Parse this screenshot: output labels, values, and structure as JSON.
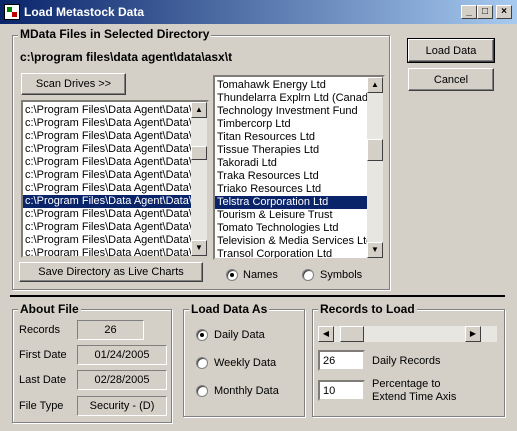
{
  "window": {
    "title": "Load Metastock Data",
    "min_glyph": "_",
    "max_glyph": "□",
    "close_glyph": "×"
  },
  "data_files": {
    "legend": "MData Files in Selected Directory",
    "path": "c:\\program files\\data agent\\data\\asx\\t",
    "scan_label": "Scan Drives >>",
    "save_dir_label": "Save Directory as Live Charts",
    "dirs": [
      "c:\\Program Files\\Data Agent\\Data\\",
      "c:\\Program Files\\Data Agent\\Data\\",
      "c:\\Program Files\\Data Agent\\Data\\",
      "c:\\Program Files\\Data Agent\\Data\\",
      "c:\\Program Files\\Data Agent\\Data\\",
      "c:\\Program Files\\Data Agent\\Data\\",
      "c:\\Program Files\\Data Agent\\Data\\",
      "c:\\Program Files\\Data Agent\\Data\\",
      "c:\\Program Files\\Data Agent\\Data\\",
      "c:\\Program Files\\Data Agent\\Data\\",
      "c:\\Program Files\\Data Agent\\Data\\",
      "c:\\Program Files\\Data Agent\\Data\\"
    ],
    "dirs_selected_index": 7,
    "securities": [
      "Tomahawk Energy Ltd",
      "Thundelarra Explrn Ltd (Canada",
      "Technology Investment Fund",
      "Timbercorp Ltd",
      "Titan Resources Ltd",
      "Tissue Therapies Ltd",
      "Takoradi Ltd",
      "Traka Resources Ltd",
      "Triako Resources Ltd",
      "Telstra Corporation Ltd",
      "Tourism & Leisure Trust",
      "Tomato Technologies Ltd",
      "Television & Media Services Ltc",
      "Transol Corporation Ltd"
    ],
    "securities_selected_index": 9,
    "names_label": "Names",
    "symbols_label": "Symbols"
  },
  "buttons": {
    "load_data": "Load Data",
    "cancel": "Cancel"
  },
  "about_file": {
    "legend": "About File",
    "records_label": "Records",
    "records_value": "26",
    "first_date_label": "First Date",
    "first_date_value": "01/24/2005",
    "last_date_label": "Last Date",
    "last_date_value": "02/28/2005",
    "file_type_label": "File Type",
    "file_type_value": "Security - (D)"
  },
  "load_as": {
    "legend": "Load Data As",
    "daily": "Daily Data",
    "weekly": "Weekly Data",
    "monthly": "Monthly Data"
  },
  "records_to_load": {
    "legend": "Records to Load",
    "slider_level": 0.05,
    "daily_records_value": "26",
    "daily_records_label": "Daily Records",
    "percentage_value": "10",
    "percentage_label_1": "Percentage to",
    "percentage_label_2": "Extend Time Axis"
  }
}
